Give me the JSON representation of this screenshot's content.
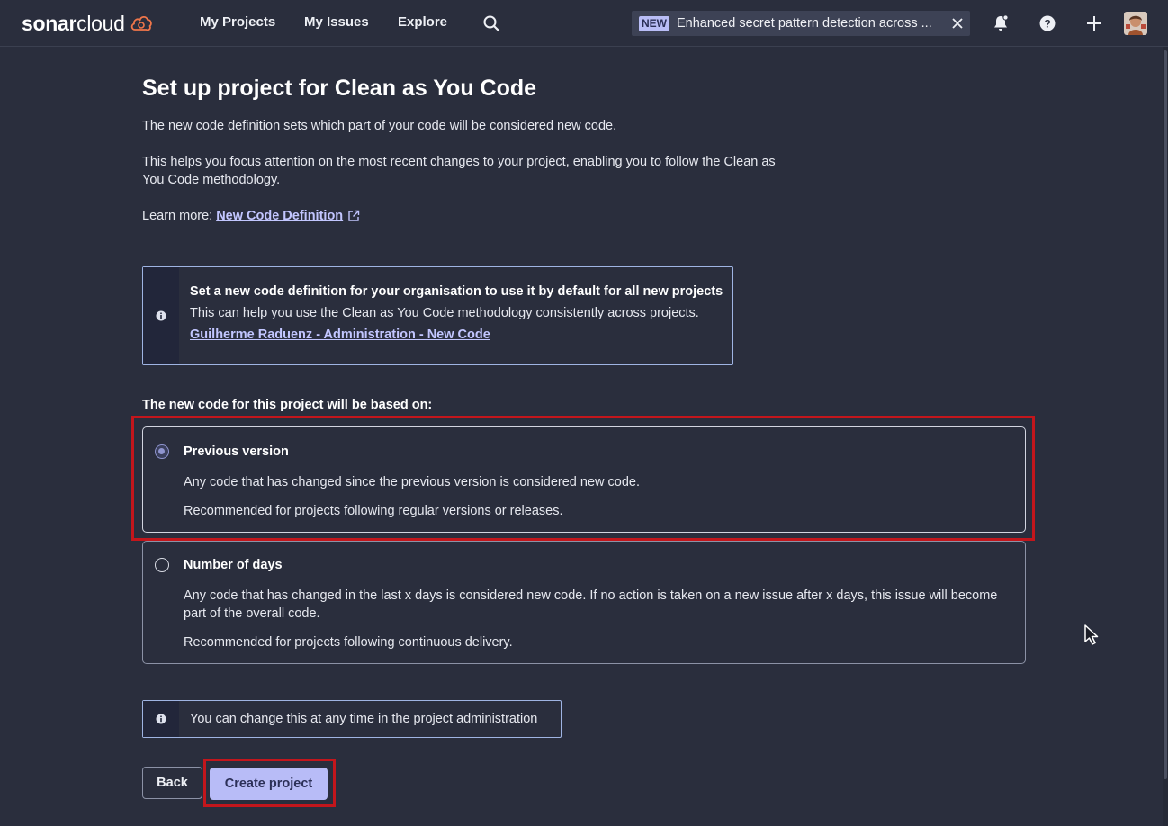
{
  "nav": {
    "logo_bold": "sonar",
    "logo_light": "cloud",
    "links": [
      "My Projects",
      "My Issues",
      "Explore"
    ],
    "announcement_tag": "NEW",
    "announcement_text": "Enhanced secret pattern detection across ..."
  },
  "page": {
    "title": "Set up project for Clean as You Code",
    "intro1": "The new code definition sets which part of your code will be considered new code.",
    "intro2_line1": "This helps you focus attention on the most recent changes to your project, enabling you to follow the Clean as",
    "intro2_line2": "You Code methodology.",
    "learn_more_label": "Learn more:",
    "learn_more_link": "New Code Definition"
  },
  "org_banner": {
    "title": "Set a new code definition for your organisation to use it by default for all new projects",
    "text": "This can help you use the Clean as You Code methodology consistently across projects.",
    "link": "Guilherme Raduenz - Administration - New Code"
  },
  "options_heading": "The new code for this project will be based on:",
  "options": [
    {
      "title": "Previous version",
      "line1": "Any code that has changed since the previous version is considered new code.",
      "line2": "Recommended for projects following regular versions or releases.",
      "selected": true
    },
    {
      "title": "Number of days",
      "line1": "Any code that has changed in the last x days is considered new code. If no action is taken on a new issue after x days, this issue will become part of the overall code.",
      "line2": "Recommended for projects following continuous delivery.",
      "selected": false
    }
  ],
  "change_note": "You can change this at any time in the project administration",
  "buttons": {
    "back": "Back",
    "create": "Create project"
  },
  "colors": {
    "background": "#2a2e3d",
    "accent": "#b8bcf7",
    "link": "#c2c6ff",
    "highlight": "#c3161c"
  }
}
